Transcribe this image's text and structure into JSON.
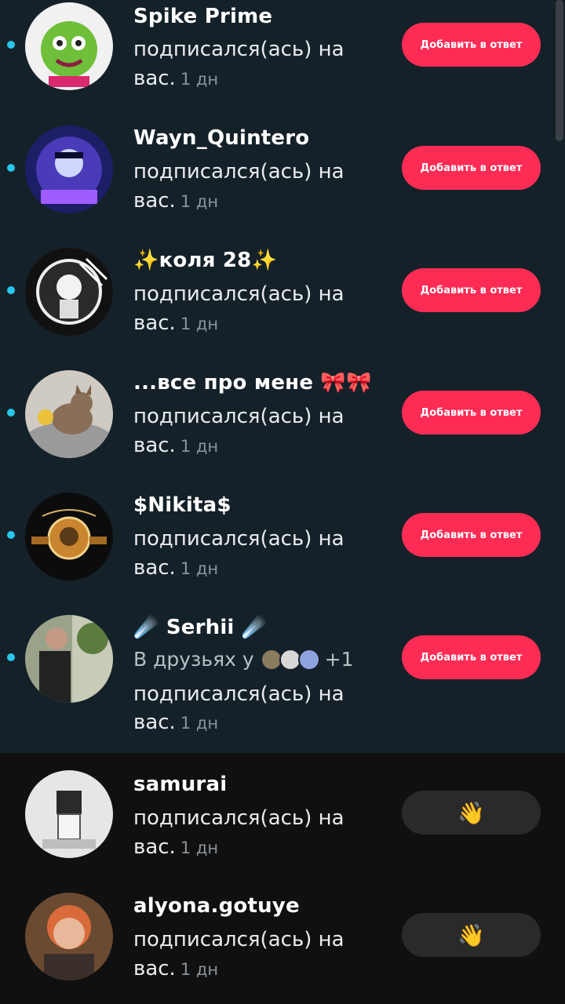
{
  "followed_text": "подписался(ась) на",
  "followed_text_2": "вас.",
  "time": "1 дн",
  "button_label": "Добавить в ответ",
  "wave_icon": "👋",
  "notifications": [
    {
      "name": "Spike Prime",
      "unread": true
    },
    {
      "name": "Wayn_Quintero",
      "unread": true
    },
    {
      "name": "✨коля 28✨",
      "unread": true
    },
    {
      "name": "...все про мене 🎀🎀",
      "unread": true
    },
    {
      "name": "$Nikita$",
      "unread": true
    },
    {
      "name": "☄️ Serhii ☄️",
      "unread": true,
      "friends_text": "В друзьях у",
      "friends_extra": "+1"
    },
    {
      "name": "samurai",
      "unread": false
    },
    {
      "name": "alyona.gotuye",
      "unread": false
    }
  ],
  "colors": {
    "accent": "#fe2c55",
    "unread_dot": "#27c6ea",
    "background": "#141a1f"
  }
}
